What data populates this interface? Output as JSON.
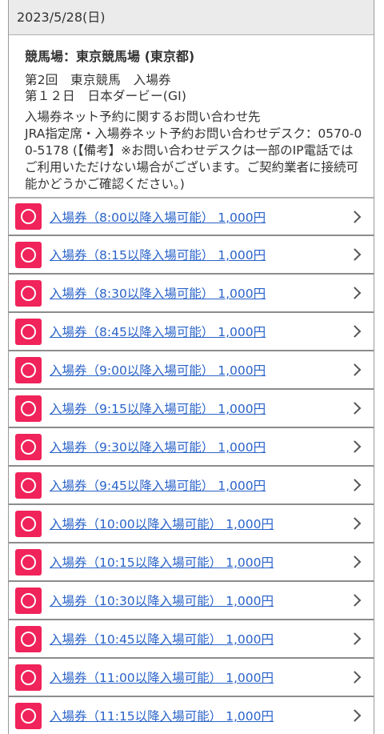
{
  "header": {
    "date": "2023/5/28(日)"
  },
  "info": {
    "venue": "競馬場：東京競馬場 (東京都)",
    "meeting": "第2回　東京競馬　入場券",
    "race": "第１２日　日本ダービー(GⅠ)",
    "contact_heading": "入場券ネット予約に関するお問い合わせ先",
    "contact_body": "JRA指定席・入場券ネット予約お問い合わせデスク：0570-00-5178 (【備考】※お問い合わせデスクは一部のIP電話ではご利用いただけない場合がございます。ご契約業者に接続可能かどうかご確認ください。)"
  },
  "tickets": [
    {
      "label": "入場券（8:00以降入場可能） 1,000円",
      "status": "available"
    },
    {
      "label": "入場券（8:15以降入場可能） 1,000円",
      "status": "available"
    },
    {
      "label": "入場券（8:30以降入場可能） 1,000円",
      "status": "available"
    },
    {
      "label": "入場券（8:45以降入場可能） 1,000円",
      "status": "available"
    },
    {
      "label": "入場券（9:00以降入場可能） 1,000円",
      "status": "available"
    },
    {
      "label": "入場券（9:15以降入場可能） 1,000円",
      "status": "available"
    },
    {
      "label": "入場券（9:30以降入場可能） 1,000円",
      "status": "available"
    },
    {
      "label": "入場券（9:45以降入場可能） 1,000円",
      "status": "available"
    },
    {
      "label": "入場券（10:00以降入場可能） 1,000円",
      "status": "available"
    },
    {
      "label": "入場券（10:15以降入場可能） 1,000円",
      "status": "available"
    },
    {
      "label": "入場券（10:30以降入場可能） 1,000円",
      "status": "available"
    },
    {
      "label": "入場券（10:45以降入場可能） 1,000円",
      "status": "available"
    },
    {
      "label": "入場券（11:00以降入場可能） 1,000円",
      "status": "available"
    },
    {
      "label": "入場券（11:15以降入場可能） 1,000円",
      "status": "available"
    }
  ],
  "colors": {
    "status_available": "#f0235a",
    "link": "#2a63c9",
    "header_bg": "#ebebeb"
  },
  "icons": {
    "status": "circle-available-icon",
    "row_arrow": "chevron-right-icon"
  }
}
